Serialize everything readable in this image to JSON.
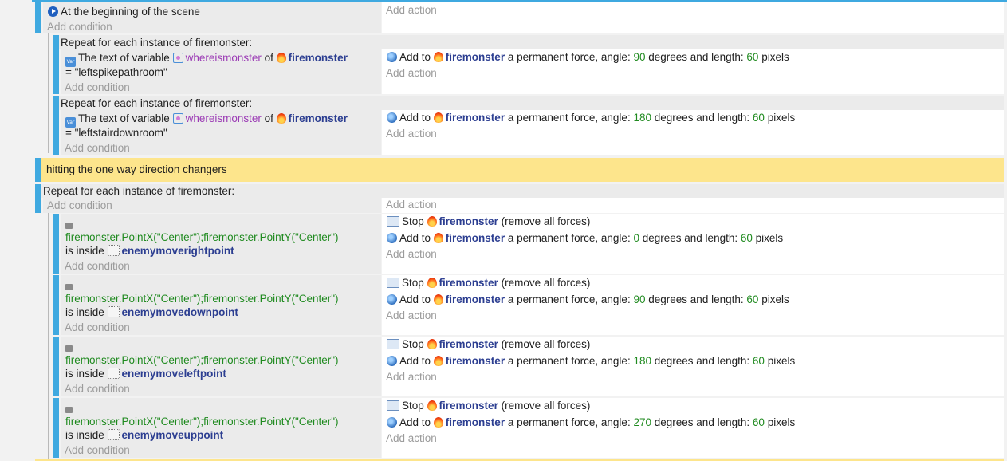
{
  "common": {
    "add_condition": "Add condition",
    "add_action": "Add action",
    "add_to": "Add to",
    "a_permanent_force": "a permanent force, angle:",
    "degrees_and_length": "degrees and length:",
    "pixels": "pixels",
    "stop": "Stop",
    "remove_all_forces": "(remove all forces)",
    "is_inside": "is inside",
    "repeat_for_each": "Repeat for each instance of firemonster:",
    "text_of_variable": "The text of variable",
    "of": "of",
    "object": "firemonster",
    "variable": "whereismonster",
    "expression": "firemonster.PointX(\"Center\");firemonster.PointY(\"Center\")"
  },
  "events": {
    "scene_start": {
      "condition": "At the beginning of the scene"
    },
    "sub1": {
      "value": "= \"leftspikepathroom\"",
      "angle": "90",
      "length": "60"
    },
    "sub2": {
      "value": "= \"leftstairdownroom\"",
      "angle": "180",
      "length": "60"
    },
    "comment": "hitting the one way direction changers",
    "rows": [
      {
        "point": "enemymoverightpoint",
        "angle": "0",
        "length": "60"
      },
      {
        "point": "enemymovedownpoint",
        "angle": "90",
        "length": "60"
      },
      {
        "point": "enemymoveleftpoint",
        "angle": "180",
        "length": "60"
      },
      {
        "point": "enemymoveuppoint",
        "angle": "270",
        "length": "60"
      }
    ]
  },
  "colors": {
    "accent": "#3fa9e0",
    "comment_bg": "#fde58c",
    "number": "#1f8a1f",
    "object": "#2c3e91",
    "variable": "#9b3bb5"
  },
  "icons": [
    "scene-start-icon",
    "variable-icon",
    "fire-object-icon",
    "force-icon",
    "stop-icon",
    "point-object-icon"
  ]
}
